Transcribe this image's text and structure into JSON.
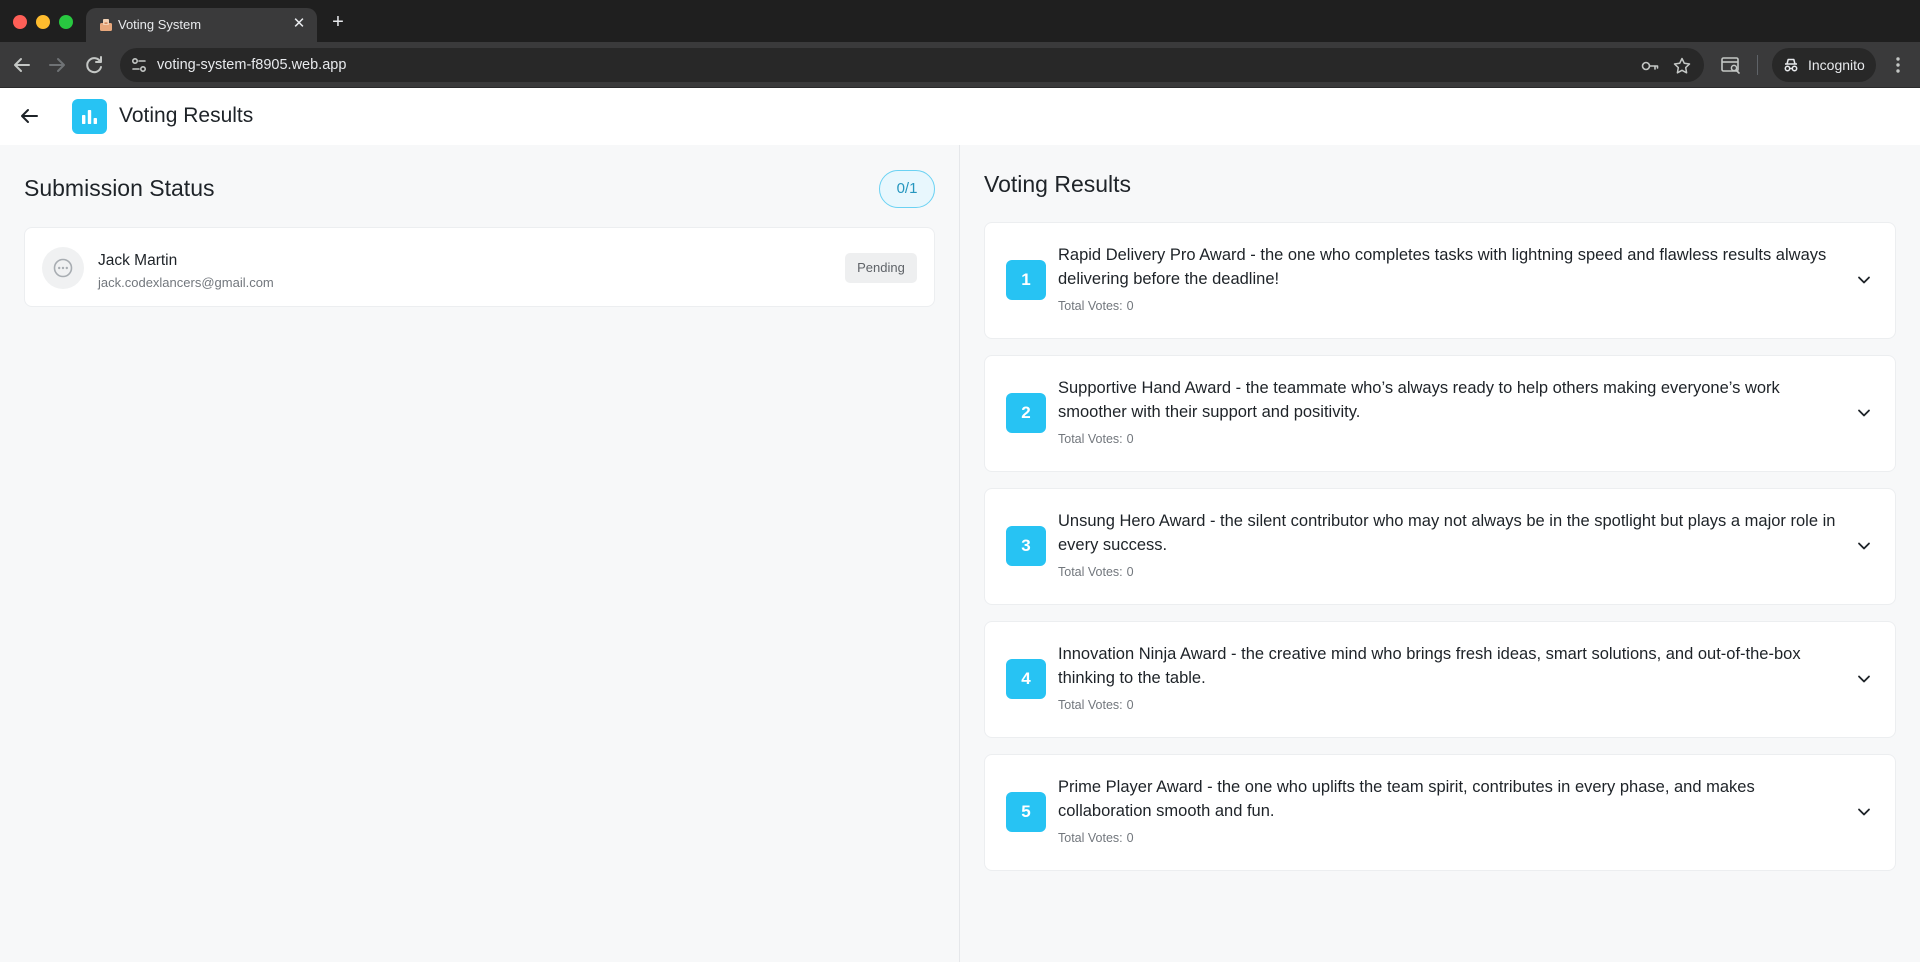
{
  "browser": {
    "tab_title": "Voting System",
    "url": "voting-system-f8905.web.app",
    "incognito_label": "Incognito"
  },
  "header": {
    "title": "Voting Results"
  },
  "submission": {
    "title": "Submission Status",
    "count": "0/1",
    "users": [
      {
        "name": "Jack Martin",
        "email": "jack.codexlancers@gmail.com",
        "status": "Pending"
      }
    ]
  },
  "results": {
    "title": "Voting Results",
    "votes_label": "Total Votes:",
    "items": [
      {
        "rank": "1",
        "text": "Rapid Delivery Pro Award - the one who completes tasks with lightning speed and flawless results always delivering before the deadline!",
        "votes": "0"
      },
      {
        "rank": "2",
        "text": "Supportive Hand Award - the teammate who’s always ready to help others making everyone’s work smoother with their support and positivity.",
        "votes": "0"
      },
      {
        "rank": "3",
        "text": "Unsung Hero Award - the silent contributor who may not always be in the spotlight but plays a major role in every success.",
        "votes": "0"
      },
      {
        "rank": "4",
        "text": "Innovation Ninja Award - the creative mind who brings fresh ideas, smart solutions, and out-of-the-box thinking to the table.",
        "votes": "0"
      },
      {
        "rank": "5",
        "text": "Prime Player Award -  the one who uplifts the team spirit, contributes in every phase, and makes collaboration smooth and fun.",
        "votes": "0"
      }
    ]
  },
  "colors": {
    "accent": "#27c3f3",
    "accent_text": "#2596be",
    "page_bg": "#f7f8f9",
    "card_bg": "#ffffff"
  }
}
